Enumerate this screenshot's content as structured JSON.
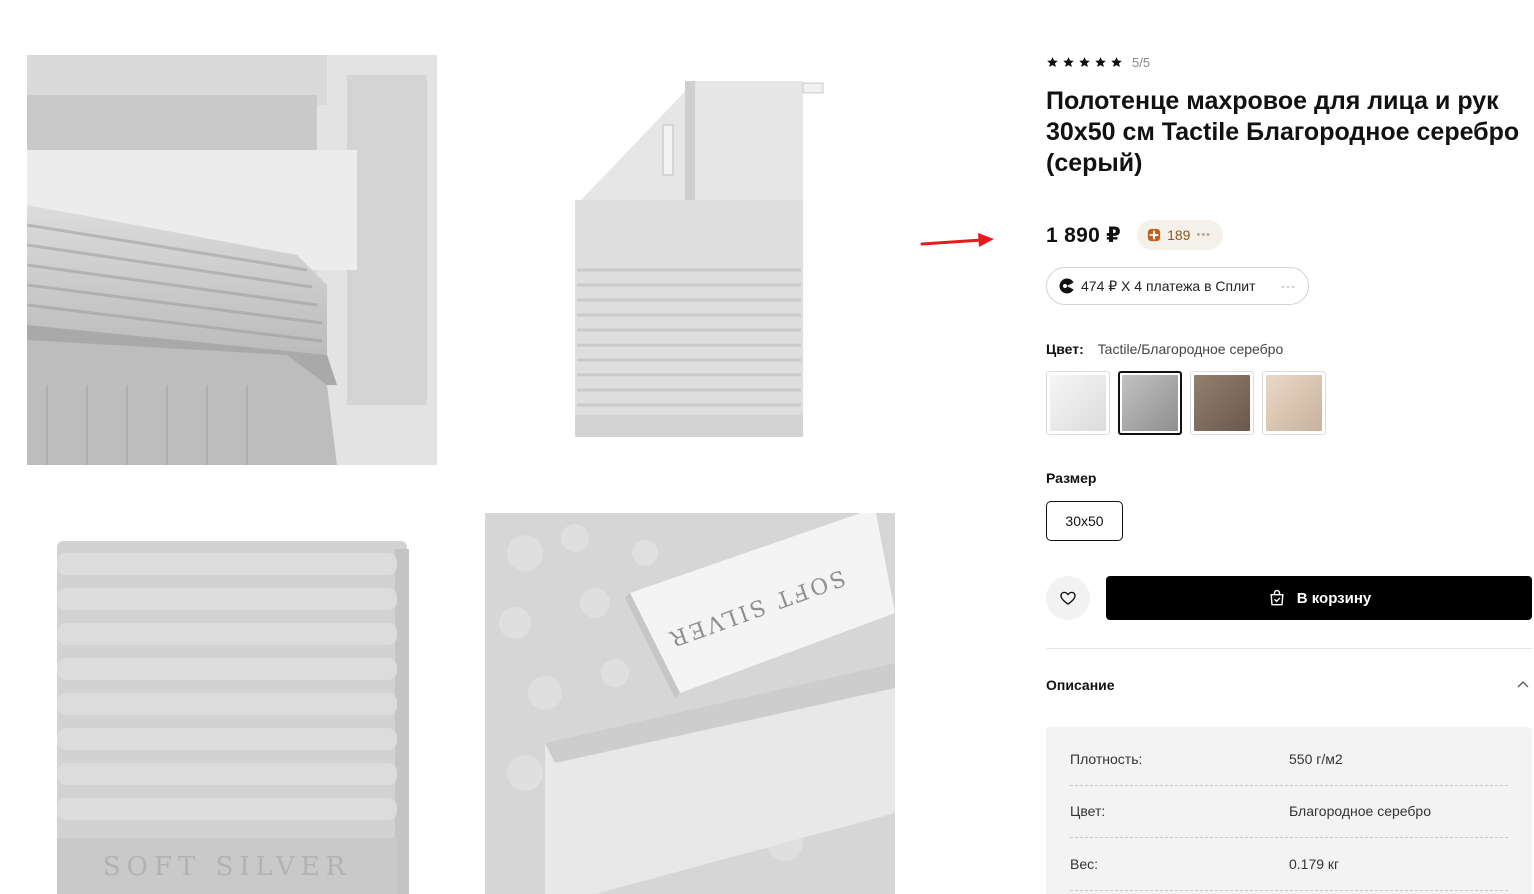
{
  "product": {
    "rating_text": "5/5",
    "rating_stars": 5,
    "title": "Полотенце махровое для лица и рук 30х50 см Tactile Благородное серебро (серый)",
    "price": "1 890 ₽",
    "bonus": "189",
    "split_text": "474 ₽ X 4 платежа в Сплит",
    "split_more": "···"
  },
  "gallery": {
    "label_text": "SOFT SILVER"
  },
  "color": {
    "label": "Цвет:",
    "value": "Tactile/Благородное серебро",
    "swatches": [
      {
        "name": "white",
        "color": "#ececec",
        "selected": false
      },
      {
        "name": "silver",
        "color": "#a9a9a9",
        "selected": true
      },
      {
        "name": "brown",
        "color": "#7d6a5a",
        "selected": false
      },
      {
        "name": "beige",
        "color": "#d9c4b0",
        "selected": false
      }
    ]
  },
  "size": {
    "label": "Размер",
    "option": "30х50"
  },
  "actions": {
    "cart_label": "В корзину"
  },
  "description": {
    "title": "Описание",
    "specs": [
      {
        "key": "Плотность:",
        "value": "550 г/м2"
      },
      {
        "key": "Цвет:",
        "value": "Благородное серебро"
      },
      {
        "key": "Вес:",
        "value": "0.179 кг"
      }
    ]
  },
  "colors": {
    "accent": "#000000",
    "arrow": "#e31d1d",
    "bonus_bg": "#f4f0ea",
    "bonus_text": "#8a5a22"
  }
}
